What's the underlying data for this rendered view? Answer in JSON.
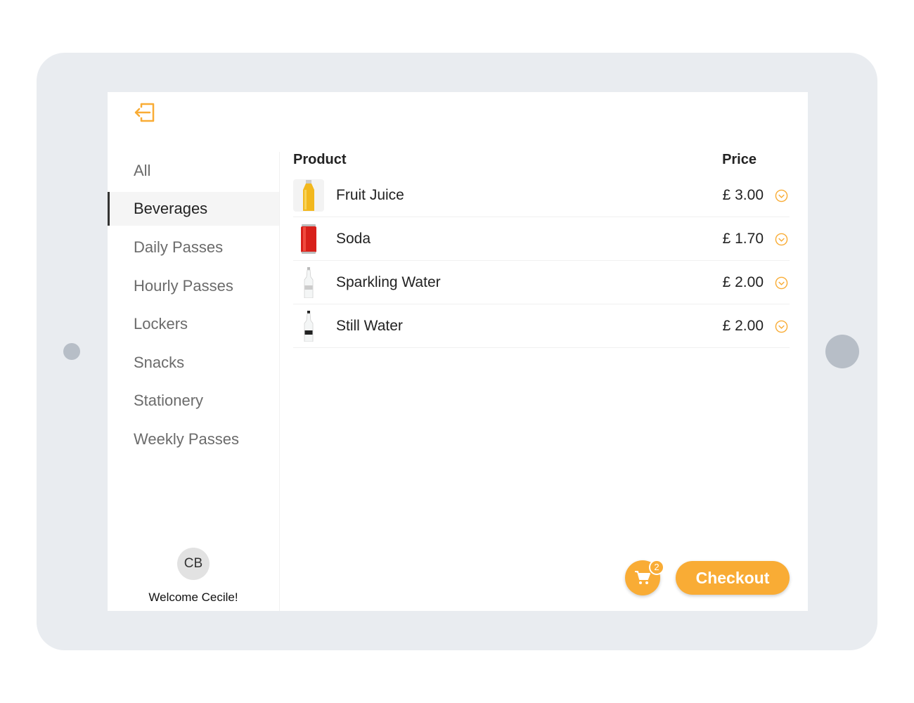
{
  "accent_color": "#F9AC35",
  "header": {
    "logout_icon": "logout-icon"
  },
  "sidebar": {
    "items": [
      {
        "label": "All",
        "selected": false
      },
      {
        "label": "Beverages",
        "selected": true
      },
      {
        "label": "Daily Passes",
        "selected": false
      },
      {
        "label": "Hourly Passes",
        "selected": false
      },
      {
        "label": "Lockers",
        "selected": false
      },
      {
        "label": "Snacks",
        "selected": false
      },
      {
        "label": "Stationery",
        "selected": false
      },
      {
        "label": "Weekly Passes",
        "selected": false
      }
    ]
  },
  "user": {
    "initials": "CB",
    "welcome": "Welcome Cecile!"
  },
  "table": {
    "columns": {
      "product": "Product",
      "price": "Price"
    },
    "rows": [
      {
        "name": "Fruit Juice",
        "price": "£ 3.00",
        "image": "juice-bottle"
      },
      {
        "name": "Soda",
        "price": "£ 1.70",
        "image": "soda-can"
      },
      {
        "name": "Sparkling Water",
        "price": "£ 2.00",
        "image": "water-bottle"
      },
      {
        "name": "Still Water",
        "price": "£ 2.00",
        "image": "water-bottle-black-label"
      }
    ]
  },
  "cart": {
    "count": "2"
  },
  "checkout_label": "Checkout"
}
